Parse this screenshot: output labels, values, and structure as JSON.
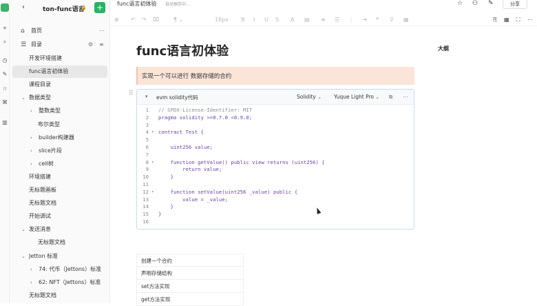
{
  "app": {
    "title": "ton-func语言",
    "doc_title": "func语言初体验",
    "save_status": "自动保存中..."
  },
  "topbar": {
    "share_label": "分享",
    "icons": [
      "star-icon",
      "users-icon",
      "edit-icon",
      "image-icon"
    ]
  },
  "toolbar": {
    "font_size": "16px"
  },
  "sidebar": {
    "home_label": "首页",
    "toc_label": "目录",
    "items": [
      {
        "label": "开发环境搭建",
        "depth": 0,
        "arrow": false,
        "active": false
      },
      {
        "label": "func语言初体验",
        "depth": 0,
        "arrow": false,
        "active": true
      },
      {
        "label": "课程目录",
        "depth": 0,
        "arrow": false,
        "active": false
      },
      {
        "label": "数据类型",
        "depth": 0,
        "arrow": "down",
        "active": false
      },
      {
        "label": "整数类型",
        "depth": 1,
        "arrow": "right",
        "active": false
      },
      {
        "label": "布尔类型",
        "depth": 2,
        "arrow": false,
        "active": false
      },
      {
        "label": "builder构建器",
        "depth": 1,
        "arrow": "right",
        "active": false
      },
      {
        "label": "slice片段",
        "depth": 1,
        "arrow": "right",
        "active": false
      },
      {
        "label": "cell树",
        "depth": 1,
        "arrow": "right",
        "active": false
      },
      {
        "label": "环境搭建",
        "depth": 0,
        "arrow": false,
        "active": false
      },
      {
        "label": "无标题画板",
        "depth": 0,
        "arrow": false,
        "active": false
      },
      {
        "label": "无标题文档",
        "depth": 0,
        "arrow": false,
        "active": false
      },
      {
        "label": "开始调试",
        "depth": 0,
        "arrow": false,
        "active": false
      },
      {
        "label": "发送消息",
        "depth": 0,
        "arrow": "down",
        "active": false
      },
      {
        "label": "无标题文档",
        "depth": 2,
        "arrow": false,
        "active": false
      },
      {
        "label": "Jetton 标准",
        "depth": 0,
        "arrow": "down",
        "active": false
      },
      {
        "label": "74: 代币（Jettons）标准",
        "depth": 1,
        "arrow": "right",
        "active": false
      },
      {
        "label": "62: NFT（Jettons）标准",
        "depth": 1,
        "arrow": "right",
        "active": false
      },
      {
        "label": "无标题文档",
        "depth": 0,
        "arrow": false,
        "active": false
      }
    ]
  },
  "document": {
    "heading": "func语言初体验",
    "callout": "实现一个可以进行 数据存储的合约",
    "outline_label": "大纲"
  },
  "code_block": {
    "title": "evm solidity代码",
    "language": "Solidity",
    "theme": "Yuque Light Pro",
    "lines": [
      {
        "n": "1",
        "fold": "",
        "code": "// SPDX-License-Identifier: MIT",
        "comment": true
      },
      {
        "n": "2",
        "fold": "",
        "code": "pragma solidity >=0.7.0 <0.9.0;",
        "comment": false
      },
      {
        "n": "3",
        "fold": "",
        "code": "",
        "comment": false
      },
      {
        "n": "4",
        "fold": "▾",
        "code": "contract Test {",
        "comment": false
      },
      {
        "n": "5",
        "fold": "",
        "code": "",
        "comment": false
      },
      {
        "n": "6",
        "fold": "",
        "code": "    uint256 value;",
        "comment": false
      },
      {
        "n": "7",
        "fold": "",
        "code": "",
        "comment": false
      },
      {
        "n": "8",
        "fold": "▾",
        "code": "    function getValue() public view returns (uint256) {",
        "comment": false
      },
      {
        "n": "9",
        "fold": "",
        "code": "        return value;",
        "comment": false
      },
      {
        "n": "10",
        "fold": "",
        "code": "    }",
        "comment": false
      },
      {
        "n": "11",
        "fold": "",
        "code": "",
        "comment": false
      },
      {
        "n": "12",
        "fold": "▾",
        "code": "    function setValue(uint256 _value) public {",
        "comment": false
      },
      {
        "n": "13",
        "fold": "",
        "code": "        value = _value;",
        "comment": false
      },
      {
        "n": "14",
        "fold": "",
        "code": "    }",
        "comment": false
      },
      {
        "n": "15",
        "fold": "",
        "code": "}",
        "comment": false
      },
      {
        "n": "16",
        "fold": "",
        "code": "",
        "comment": false
      }
    ]
  },
  "toc": {
    "items": [
      "创建一个合约",
      "声明存储结构",
      "set方法实现",
      "get方法实现"
    ]
  }
}
